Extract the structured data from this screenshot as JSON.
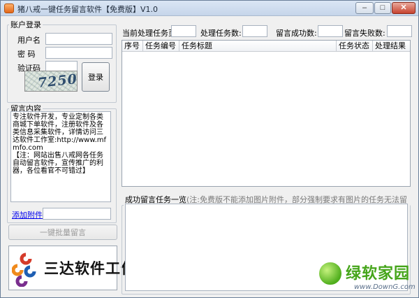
{
  "window": {
    "title": "猪八戒一键任务留言软件【免费版】V1.0",
    "minimize_glyph": "–",
    "maximize_glyph": "□",
    "close_glyph": "✕"
  },
  "login": {
    "group_title": "账户登录",
    "username_label": "用户名",
    "username_value": "",
    "password_label": "密  码",
    "password_value": "",
    "captcha_label": "验证码",
    "captcha_value": "",
    "captcha_image_text": "7250",
    "login_button": "登录"
  },
  "message": {
    "group_title": "留言内容",
    "lines": [
      "专注软件开发，专业定制各类商城下单软件，注册软件及各类信息采集软件，详情访问三达软件工作室:http://www.mfmfo.com",
      "【注：网站出售八戒网各任务自动留言软件，宣传推广的利器，各位看官不可错过】"
    ],
    "attach_link": "添加附件",
    "attach_value": "",
    "batch_button": "一键批量留言"
  },
  "logo": {
    "text": "三达软件工作室"
  },
  "stats": {
    "current_page_label": "当前处理任务页:",
    "current_page_value": "",
    "processed_label": "处理任务数:",
    "processed_value": "",
    "success_label": "留言成功数:",
    "success_value": "",
    "fail_label": "留言失败数:",
    "fail_value": ""
  },
  "table": {
    "columns": [
      "序号",
      "任务编号",
      "任务标题",
      "任务状态",
      "处理结果"
    ],
    "rows": []
  },
  "success_list": {
    "title": "成功留言任务一览",
    "note": "(注:免费版不能添加图片附件，部分强制要求有图片的任务无法留言)"
  },
  "watermark": {
    "text": "绿软家园",
    "url": "www.DownG.com"
  },
  "colors": {
    "link": "#0000ee",
    "watermark_green": "#45a51a"
  }
}
